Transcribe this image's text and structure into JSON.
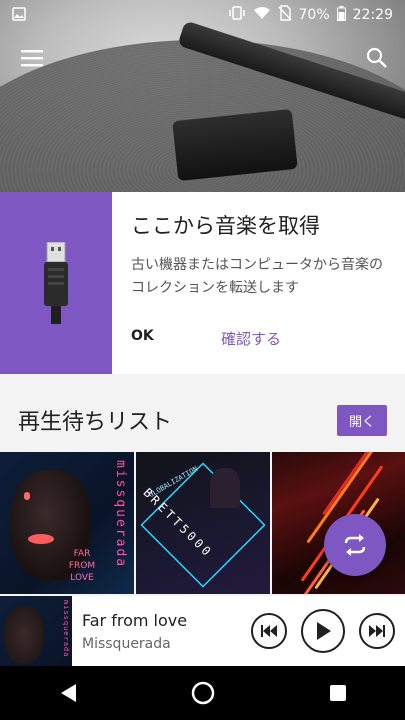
{
  "status_bar": {
    "battery_percent": "70%",
    "time": "22:29"
  },
  "header": {
    "menu_icon": "hamburger-menu-icon",
    "search_icon": "search-icon"
  },
  "get_music_card": {
    "title": "ここから音楽を取得",
    "body": "古い機器またはコンピュータから音楽のコレクションを転送します",
    "ok_label": "OK",
    "confirm_label": "確認する",
    "icon": "usb-cable-icon"
  },
  "queue": {
    "title": "再生待ちリスト",
    "open_label": "開く",
    "albums": [
      {
        "vertical_text": "missquerada",
        "caption": "FAR\nFROM\nLOVE"
      },
      {
        "diagonal_text": "BRETT5000",
        "small_text": "GLOBALIZATION"
      },
      {}
    ]
  },
  "now_playing": {
    "title": "Far from love",
    "artist": "Missquerada",
    "art_text": "missquerada"
  },
  "colors": {
    "accent": "#7e57c2"
  }
}
